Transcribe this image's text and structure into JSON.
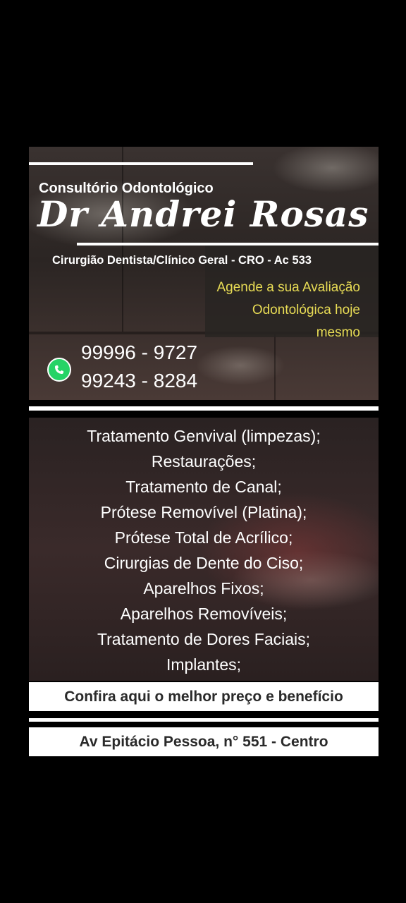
{
  "header": {
    "subtitle": "Consultório Odontológico",
    "name": "Dr Andrei Rosas",
    "specialty": "Cirurgião Dentista/Clínico Geral - CRO - Ac 533"
  },
  "cta": {
    "line1": "Agende a sua Avaliação",
    "line2": "Odontológica hoje",
    "line3": "mesmo"
  },
  "contact": {
    "icon": "whatsapp-icon",
    "phones": [
      "99996 - 9727",
      "99243 - 8284"
    ]
  },
  "services": [
    "Tratamento Genvival (limpezas);",
    "Restaurações;",
    "Tratamento de Canal;",
    "Prótese Removível (Platina);",
    "Prótese Total de Acrílico;",
    "Cirurgias de Dente do Ciso;",
    "Aparelhos Fixos;",
    "Aparelhos Removíveis;",
    "Tratamento de Dores Faciais;",
    "Implantes;"
  ],
  "promo": "Confira aqui o melhor preço e benefício",
  "address": "Av Epitácio Pessoa, n° 551 - Centro",
  "colors": {
    "background": "#000000",
    "accent_yellow": "#e8dc55",
    "whatsapp_green": "#25d366"
  }
}
